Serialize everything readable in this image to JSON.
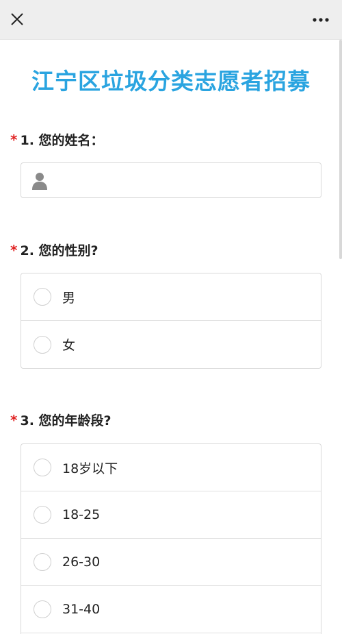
{
  "title": "江宁区垃圾分类志愿者招募",
  "questions": [
    {
      "required_mark": "*",
      "label": "1. 您的姓名："
    },
    {
      "required_mark": "*",
      "label": "2. 您的性别?",
      "options": [
        "男",
        "女"
      ]
    },
    {
      "required_mark": "*",
      "label": "3. 您的年龄段?",
      "options": [
        "18岁以下",
        "18-25",
        "26-30",
        "31-40"
      ]
    }
  ],
  "name_input": {
    "value": "",
    "placeholder": ""
  },
  "icons": {
    "close": "close-icon",
    "more": "more-icon",
    "person": "person-icon"
  },
  "colors": {
    "title": "#2aa4e0",
    "required": "#e02020",
    "topbar": "#eeeeee"
  }
}
